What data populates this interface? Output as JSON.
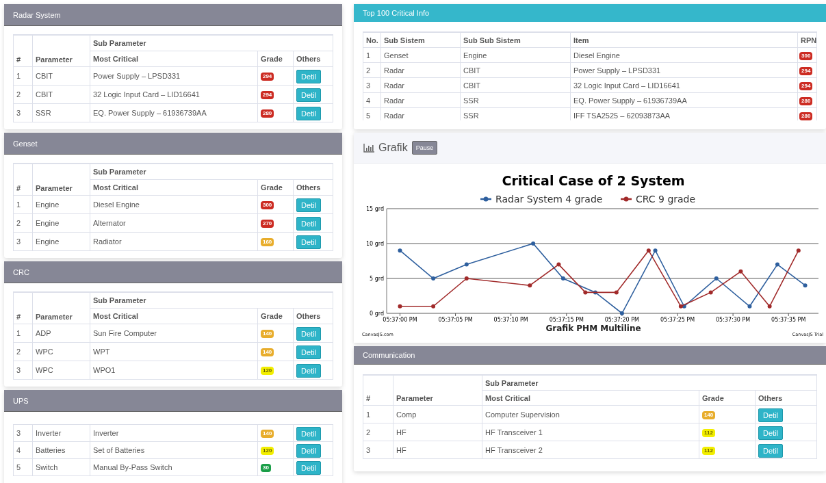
{
  "systems": [
    {
      "title": "Radar System",
      "columns": {
        "hash": "#",
        "parameter": "Parameter",
        "group": "Sub Parameter",
        "most_critical": "Most Critical",
        "grade": "Grade",
        "others": "Others"
      },
      "rows": [
        {
          "no": "1",
          "parameter": "CBIT",
          "item": "Power Supply – LPSD331",
          "grade": {
            "text": "294",
            "color": "#cc2b22"
          },
          "button": "Detil"
        },
        {
          "no": "2",
          "parameter": "CBIT",
          "item": "32 Logic Input Card – LID16641",
          "grade": {
            "text": "294",
            "color": "#cc2b22"
          },
          "button": "Detil"
        },
        {
          "no": "3",
          "parameter": "SSR",
          "item": "EQ. Power Supply – 61936739AA",
          "grade": {
            "text": "280",
            "color": "#cc2b22"
          },
          "button": "Detil"
        }
      ]
    },
    {
      "title": "Genset",
      "columns": {
        "hash": "#",
        "parameter": "Parameter",
        "group": "Sub Parameter",
        "most_critical": "Most Critical",
        "grade": "Grade",
        "others": "Others"
      },
      "rows": [
        {
          "no": "1",
          "parameter": "Engine",
          "item": "Diesel Engine",
          "grade": {
            "text": "300",
            "color": "#cc2b22"
          },
          "button": "Detil"
        },
        {
          "no": "2",
          "parameter": "Engine",
          "item": "Alternator",
          "grade": {
            "text": "270",
            "color": "#cc2b22"
          },
          "button": "Detil"
        },
        {
          "no": "3",
          "parameter": "Engine",
          "item": "Radiator",
          "grade": {
            "text": "160",
            "color": "#e8ad2c"
          },
          "button": "Detil"
        }
      ]
    },
    {
      "title": "CRC",
      "columns": {
        "hash": "#",
        "parameter": "Parameter",
        "group": "Sub Parameter",
        "most_critical": "Most Critical",
        "grade": "Grade",
        "others": "Others"
      },
      "rows": [
        {
          "no": "1",
          "parameter": "ADP",
          "item": "Sun Fire Computer",
          "grade": {
            "text": "140",
            "color": "#e8ad2c"
          },
          "button": "Detil"
        },
        {
          "no": "2",
          "parameter": "WPC",
          "item": "WPT",
          "grade": {
            "text": "140",
            "color": "#e8ad2c"
          },
          "button": "Detil"
        },
        {
          "no": "3",
          "parameter": "WPC",
          "item": "WPO1",
          "grade": {
            "text": "120",
            "color": "#f2ee00"
          },
          "button": "Detil"
        }
      ]
    },
    {
      "title": "UPS",
      "rows": [
        {
          "no": "3",
          "parameter": "Inverter",
          "item": "Inverter",
          "grade": {
            "text": "140",
            "color": "#e8ad2c"
          },
          "button": "Detil"
        },
        {
          "no": "4",
          "parameter": "Batteries",
          "item": "Set of Batteries",
          "grade": {
            "text": "120",
            "color": "#f2ee00"
          },
          "button": "Detil"
        },
        {
          "no": "5",
          "parameter": "Switch",
          "item": "Manual By-Pass Switch",
          "grade": {
            "text": "30",
            "color": "#1a9e48"
          },
          "button": "Detil"
        }
      ]
    }
  ],
  "top_critical": {
    "title": "Top 100 Critical Info",
    "columns": [
      "No.",
      "Sub Sistem",
      "Sub Sub Sistem",
      "Item",
      "RPN"
    ],
    "rows": [
      {
        "no": "1",
        "sub_system": "Genset",
        "sub_sub_system": "Engine",
        "item": "Diesel Engine",
        "rpn": "300"
      },
      {
        "no": "2",
        "sub_system": "Radar",
        "sub_sub_system": "CBIT",
        "item": "Power Supply – LPSD331",
        "rpn": "294"
      },
      {
        "no": "3",
        "sub_system": "Radar",
        "sub_sub_system": "CBIT",
        "item": "32 Logic Input Card – LID16641",
        "rpn": "294"
      },
      {
        "no": "4",
        "sub_system": "Radar",
        "sub_sub_system": "SSR",
        "item": "EQ. Power Supply – 61936739AA",
        "rpn": "280"
      },
      {
        "no": "5",
        "sub_system": "Radar",
        "sub_sub_system": "SSR",
        "item": "IFF TSA2525 – 62093873AA",
        "rpn": "280"
      }
    ]
  },
  "grafik": {
    "title": "Grafik",
    "pause_button": "Pause",
    "credit_left": "CanvasJS.com",
    "credit_right": "CanvasJS Trial",
    "chart_data": {
      "type": "line",
      "legend": "top",
      "title": "Critical Case of 2 System",
      "xlabel": "Grafik PHM Multiline",
      "xlim": [
        63418.8,
        63457.7
      ],
      "ylim": [
        0,
        15
      ],
      "yticks": [
        {
          "value": 0,
          "label": "0 grd"
        },
        {
          "value": 5,
          "label": "5 grd"
        },
        {
          "value": 10,
          "label": "10 grd"
        },
        {
          "value": 15,
          "label": "15 grd"
        }
      ],
      "xticks": [
        {
          "value": 63420,
          "label": "05:37:00 PM"
        },
        {
          "value": 63425,
          "label": "05:37:05 PM"
        },
        {
          "value": 63430,
          "label": "05:37:10 PM"
        },
        {
          "value": 63435,
          "label": "05:37:15 PM"
        },
        {
          "value": 63440,
          "label": "05:37:20 PM"
        },
        {
          "value": 63445,
          "label": "05:37:25 PM"
        },
        {
          "value": 63450,
          "label": "05:37:30 PM"
        },
        {
          "value": 63455,
          "label": "05:37:35 PM"
        }
      ],
      "series": [
        {
          "name": "Radar System 4 grade",
          "color": "#2e5f9e",
          "marker": "circle",
          "x": [
            63420,
            63423,
            63426,
            63432,
            63434.7,
            63437.6,
            63440,
            63443,
            63445.6,
            63448.5,
            63451.5,
            63454,
            63456.5
          ],
          "values": [
            9,
            5,
            7,
            10,
            5,
            3,
            0,
            9,
            1,
            5,
            1,
            7,
            4
          ]
        },
        {
          "name": "CRC 9 grade",
          "color": "#a12a2a",
          "marker": "circle",
          "x": [
            63420,
            63423,
            63426,
            63431.7,
            63434.3,
            63436.7,
            63439.5,
            63442.4,
            63445.3,
            63448,
            63450.7,
            63453.3,
            63455.9
          ],
          "values": [
            1,
            1,
            5,
            4,
            7,
            3,
            3,
            9,
            1,
            3,
            6,
            1,
            9
          ]
        }
      ]
    }
  },
  "communication": {
    "title": "Communication",
    "columns": {
      "hash": "#",
      "parameter": "Parameter",
      "group": "Sub Parameter",
      "most_critical": "Most Critical",
      "grade": "Grade",
      "others": "Others"
    },
    "rows": [
      {
        "no": "1",
        "parameter": "Comp",
        "item": "Computer Supervision",
        "grade": {
          "text": "140",
          "color": "#e8ad2c"
        },
        "button": "Detil"
      },
      {
        "no": "2",
        "parameter": "HF",
        "item": "HF Transceiver 1",
        "grade": {
          "text": "112",
          "color": "#f2ee00"
        },
        "button": "Detil"
      },
      {
        "no": "3",
        "parameter": "HF",
        "item": "HF Transceiver 2",
        "grade": {
          "text": "112",
          "color": "#f2ee00"
        },
        "button": "Detil"
      }
    ]
  }
}
